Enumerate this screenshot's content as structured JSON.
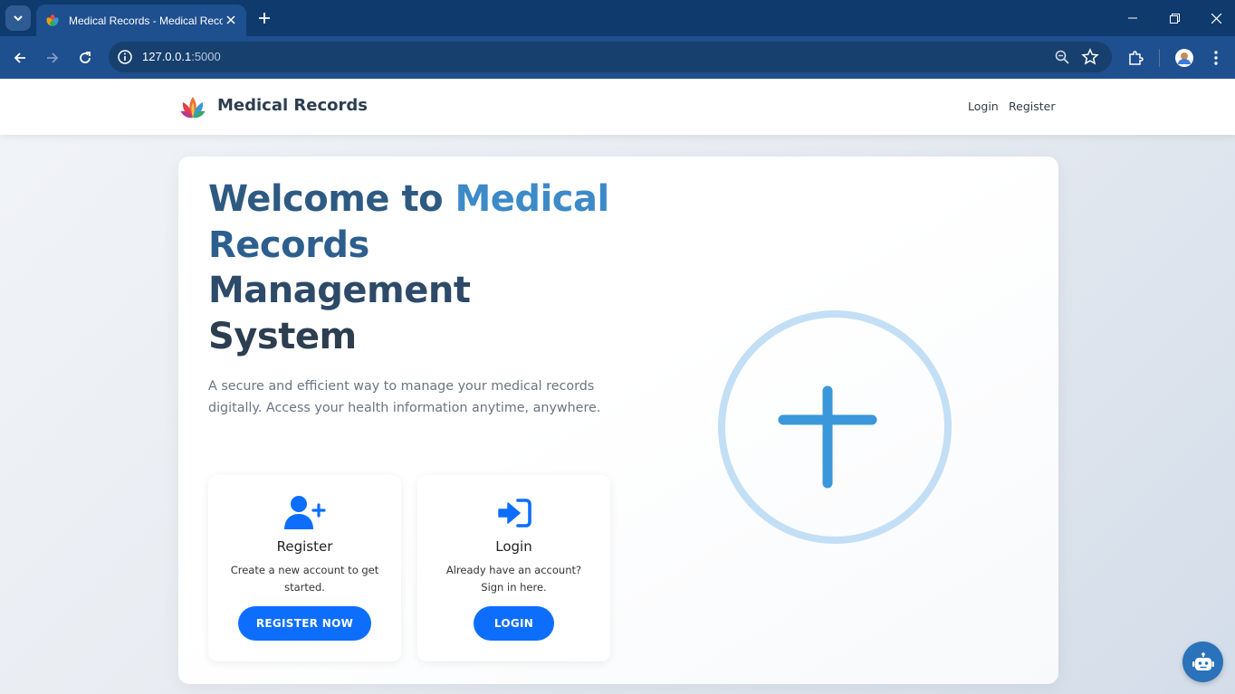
{
  "browser": {
    "tab_title": "Medical Records - Medical Records",
    "url_host": "127.0.0.1",
    "url_port": ":5000"
  },
  "header": {
    "brand": "Medical Records",
    "nav": {
      "login": "Login",
      "register": "Register"
    }
  },
  "hero": {
    "title_part1": "Welcome to ",
    "title_part2": "Medical",
    "title_part3": "Records",
    "title_part4": "Management",
    "title_part5": "System",
    "description": "A secure and efficient way to manage your medical records digitally. Access your health information anytime, anywhere."
  },
  "cards": {
    "register": {
      "icon": "user-plus-icon",
      "title": "Register",
      "text": "Create a new account to get started.",
      "button": "REGISTER NOW"
    },
    "login": {
      "icon": "sign-in-icon",
      "title": "Login",
      "text": "Already have an account? Sign in here.",
      "button": "LOGIN"
    }
  },
  "colors": {
    "primary_button": "#0d6efd",
    "title_dark": "#2c3e50",
    "title_accent": "#3d8ac8",
    "browser_frame": "#1e4f8f"
  }
}
